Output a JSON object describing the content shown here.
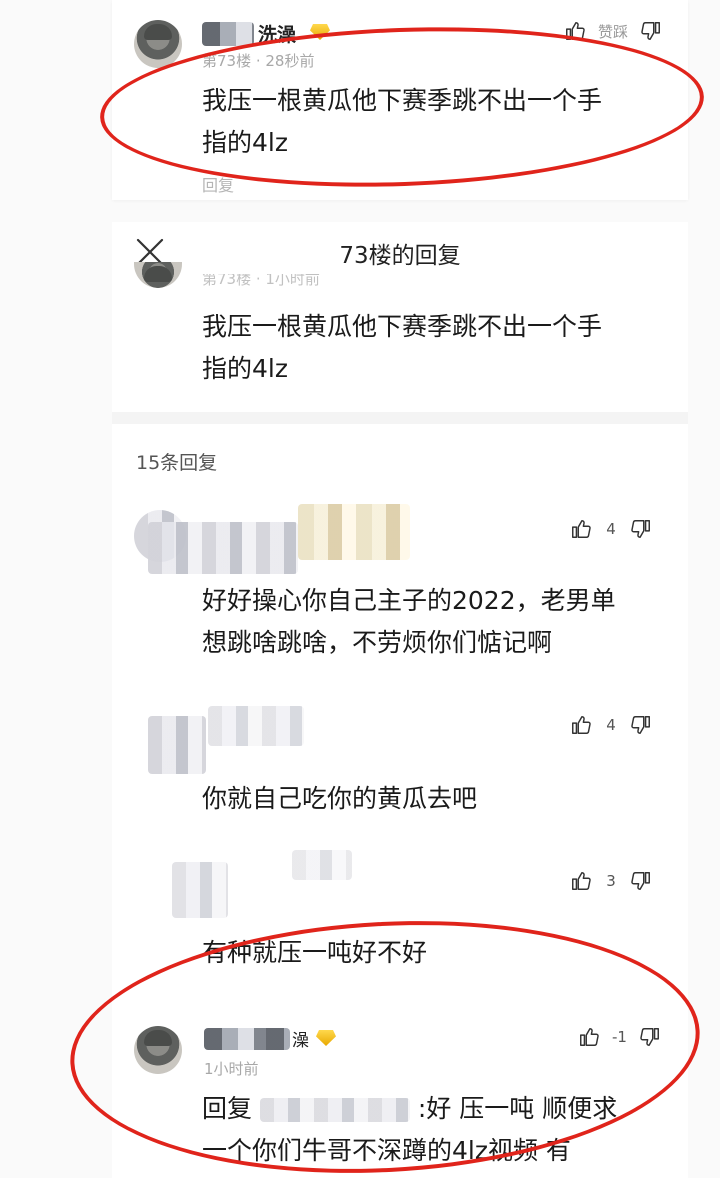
{
  "top_comment": {
    "username": "洗澡",
    "floor_time": "第73楼 · 28秒前",
    "text_line1": "我压一根黄瓜他下赛季跳不出一个手",
    "text_line2": "指的4lz",
    "reply_label": "回复",
    "like_label": "赞",
    "dislike_label": "踩"
  },
  "sheet": {
    "title": "73楼的回复",
    "quoted_meta": "第73楼 · 1小时前",
    "quoted_line1": "我压一根黄瓜他下赛季跳不出一个手",
    "quoted_line2": "指的4lz",
    "reply_count": "15条回复"
  },
  "replies": [
    {
      "likes": "4",
      "text_line1": "好好操心你自己主子的2022，老男单",
      "text_line2": "想跳啥跳啥，不劳烦你们惦记啊"
    },
    {
      "likes": "4",
      "text_line1": "你就自己吃你的黄瓜去吧"
    },
    {
      "likes": "3",
      "text_line1": "有种就压一吨好不好"
    },
    {
      "username": "澡",
      "time": "1小时前",
      "likes": "-1",
      "text_part1": "回复",
      "text_part2": ":好 压一吨 顺便求",
      "text_line2": "一个你们牛哥不深蹲的4lz视频 有"
    }
  ],
  "colors": {
    "annotation_red": "#e0241b",
    "badge_gold": "#e8a800"
  },
  "icons": [
    "thumbs-up-icon",
    "thumbs-down-icon",
    "close-icon",
    "vip-badge-icon"
  ]
}
